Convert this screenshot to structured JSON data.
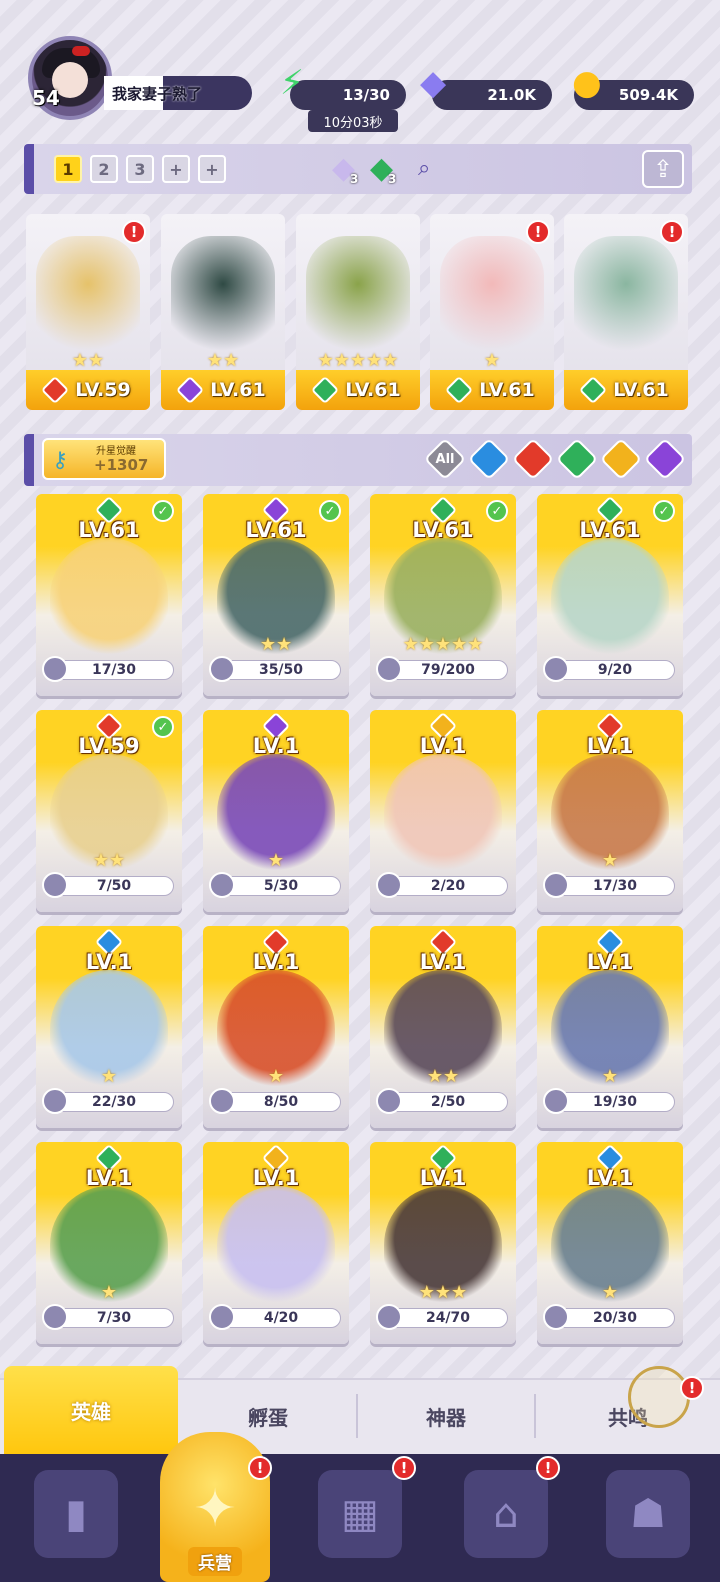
{
  "player": {
    "level": "54",
    "name": "我家妻子熟了"
  },
  "resources": {
    "energy": "13/30",
    "energy_timer": "10分03秒",
    "gems": "21.0K",
    "gold": "509.4K"
  },
  "team_tabs": [
    "1",
    "2",
    "3",
    "+",
    "+"
  ],
  "crystals": [
    {
      "count": "3",
      "color": "#b8a6e0"
    },
    {
      "count": "3",
      "color": "#2fb05a"
    }
  ],
  "team_slots": [
    {
      "level": "LV.59",
      "element": "fire",
      "stars": "★★",
      "alert": "!",
      "color": "#e6c26a"
    },
    {
      "level": "LV.61",
      "element": "dark",
      "stars": "★★",
      "alert": "",
      "color": "#2f4a44"
    },
    {
      "level": "LV.61",
      "element": "nature",
      "stars": "★★★★★",
      "alert": "",
      "color": "#8aa34a"
    },
    {
      "level": "LV.61",
      "element": "nature",
      "stars": "★",
      "alert": "!",
      "color": "#f2b9b9"
    },
    {
      "level": "LV.61",
      "element": "nature",
      "stars": "",
      "alert": "!",
      "color": "#8ab6a0"
    }
  ],
  "awaken": {
    "label": "升星觉醒",
    "value": "+1307"
  },
  "filters": [
    {
      "label": "All",
      "color": "#8c8a96"
    },
    {
      "label": "",
      "color": "#2a8de0"
    },
    {
      "label": "",
      "color": "#e23a2a"
    },
    {
      "label": "",
      "color": "#2fb05a"
    },
    {
      "label": "",
      "color": "#f2b21c"
    },
    {
      "label": "",
      "color": "#8a44d8"
    }
  ],
  "element_colors": {
    "fire": "#e23a2a",
    "dark": "#8a44d8",
    "nature": "#2fb05a",
    "water": "#2a8de0",
    "light": "#f2b21c"
  },
  "heroes": [
    {
      "level": "LV.61",
      "element": "nature",
      "progress": "17/30",
      "stars": "",
      "checked": true,
      "color": "#f7d27a"
    },
    {
      "level": "LV.61",
      "element": "dark",
      "progress": "35/50",
      "stars": "★★",
      "checked": true,
      "color": "#4a6a6a"
    },
    {
      "level": "LV.61",
      "element": "nature",
      "progress": "79/200",
      "stars": "★★★★★",
      "checked": true,
      "color": "#9ab060"
    },
    {
      "level": "LV.61",
      "element": "nature",
      "progress": "9/20",
      "stars": "",
      "checked": true,
      "color": "#b8d6c8"
    },
    {
      "level": "LV.59",
      "element": "fire",
      "progress": "7/50",
      "stars": "★★",
      "checked": true,
      "color": "#e8d090"
    },
    {
      "level": "LV.1",
      "element": "dark",
      "progress": "5/30",
      "stars": "★",
      "checked": false,
      "color": "#7a4ab8"
    },
    {
      "level": "LV.1",
      "element": "light",
      "progress": "2/20",
      "stars": "",
      "checked": false,
      "color": "#f0c6b8"
    },
    {
      "level": "LV.1",
      "element": "fire",
      "progress": "17/30",
      "stars": "★",
      "checked": false,
      "color": "#c87a4a"
    },
    {
      "level": "LV.1",
      "element": "water",
      "progress": "22/30",
      "stars": "★",
      "checked": false,
      "color": "#a8c8e8"
    },
    {
      "level": "LV.1",
      "element": "fire",
      "progress": "8/50",
      "stars": "★",
      "checked": false,
      "color": "#d8502a"
    },
    {
      "level": "LV.1",
      "element": "fire",
      "progress": "2/50",
      "stars": "★★",
      "checked": false,
      "color": "#5a4a5a"
    },
    {
      "level": "LV.1",
      "element": "water",
      "progress": "19/30",
      "stars": "★",
      "checked": false,
      "color": "#6a7ab0"
    },
    {
      "level": "LV.1",
      "element": "nature",
      "progress": "7/30",
      "stars": "★",
      "checked": false,
      "color": "#5aa050"
    },
    {
      "level": "LV.1",
      "element": "light",
      "progress": "4/20",
      "stars": "",
      "checked": false,
      "color": "#c8c0f0"
    },
    {
      "level": "LV.1",
      "element": "nature",
      "progress": "24/70",
      "stars": "★★★",
      "checked": false,
      "color": "#4a3a3a"
    },
    {
      "level": "LV.1",
      "element": "water",
      "progress": "20/30",
      "stars": "★",
      "checked": false,
      "color": "#6a8090"
    }
  ],
  "sub_tabs": [
    "英雄",
    "孵蛋",
    "神器",
    "共鸣"
  ],
  "nav": {
    "active_label": "兵营",
    "alert": "!"
  }
}
